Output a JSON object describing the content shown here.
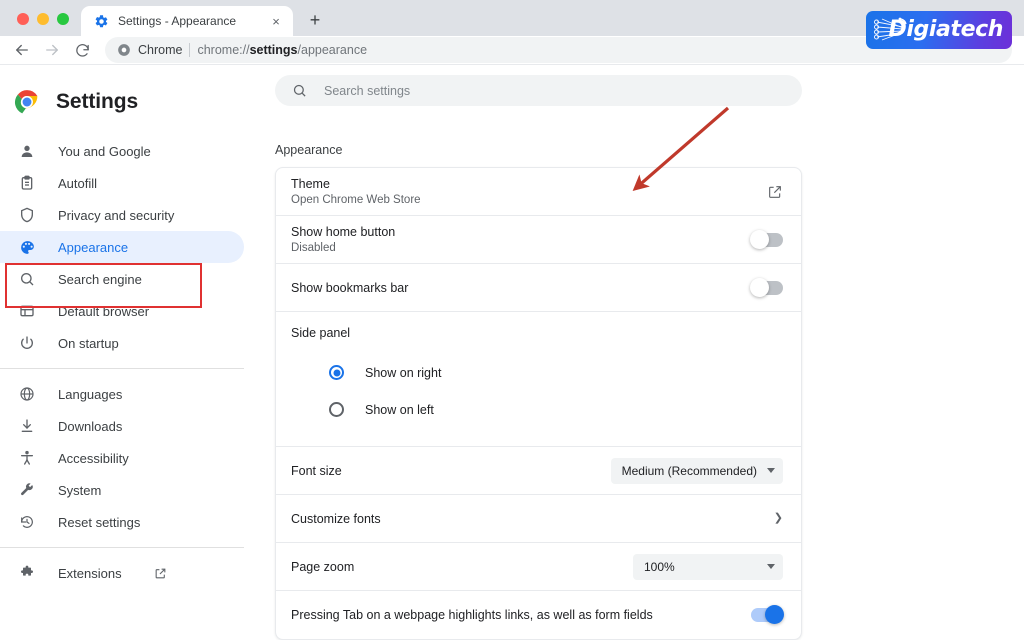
{
  "browser": {
    "tab": {
      "title": "Settings - Appearance",
      "favicon": "settings-gear-icon",
      "close": "×"
    },
    "new_tab_label": "+",
    "back_icon": "←",
    "forward_icon": "→",
    "reload_icon": "↻",
    "url_chip": "Chrome",
    "url_prefix": "chrome://",
    "url_bold": "settings",
    "url_suffix": "/appearance"
  },
  "logo": {
    "text": "Digiatech"
  },
  "settings": {
    "title": "Settings",
    "search": {
      "placeholder": "Search settings",
      "value": ""
    },
    "sidebar": [
      {
        "label": "You and Google",
        "icon": "person-icon",
        "selected": false
      },
      {
        "label": "Autofill",
        "icon": "clipboard-icon",
        "selected": false
      },
      {
        "label": "Privacy and security",
        "icon": "shield-icon",
        "selected": false
      },
      {
        "label": "Appearance",
        "icon": "palette-icon",
        "selected": true
      },
      {
        "label": "Search engine",
        "icon": "magnifier-icon",
        "selected": false
      },
      {
        "label": "Default browser",
        "icon": "browser-window-icon",
        "selected": false
      },
      {
        "label": "On startup",
        "icon": "power-icon",
        "selected": false
      },
      {
        "label": "Languages",
        "icon": "globe-icon",
        "selected": false
      },
      {
        "label": "Downloads",
        "icon": "download-icon",
        "selected": false
      },
      {
        "label": "Accessibility",
        "icon": "accessibility-icon",
        "selected": false
      },
      {
        "label": "System",
        "icon": "wrench-icon",
        "selected": false
      },
      {
        "label": "Reset settings",
        "icon": "restore-icon",
        "selected": false
      },
      {
        "label": "Extensions",
        "icon": "puzzle-icon",
        "selected": false,
        "external": true
      }
    ],
    "section_title": "Appearance",
    "rows": {
      "theme": {
        "title": "Theme",
        "sub": "Open Chrome Web Store",
        "action_icon": "external-link-icon"
      },
      "home_button": {
        "title": "Show home button",
        "sub": "Disabled",
        "toggle_on": false
      },
      "bookmarks_bar": {
        "title": "Show bookmarks bar",
        "toggle_on": false
      },
      "side_panel": {
        "title": "Side panel",
        "options": [
          {
            "label": "Show on right",
            "checked": true
          },
          {
            "label": "Show on left",
            "checked": false
          }
        ]
      },
      "font_size": {
        "title": "Font size",
        "value": "Medium (Recommended)"
      },
      "customize_fonts": {
        "title": "Customize fonts",
        "chevron": "❯"
      },
      "page_zoom": {
        "title": "Page zoom",
        "value": "100%"
      },
      "tab_highlight": {
        "title": "Pressing Tab on a webpage highlights links, as well as form fields",
        "toggle_on": true
      }
    }
  },
  "annotations": {
    "arrow_color": "#c0392b",
    "highlight_color": "#e03131"
  }
}
